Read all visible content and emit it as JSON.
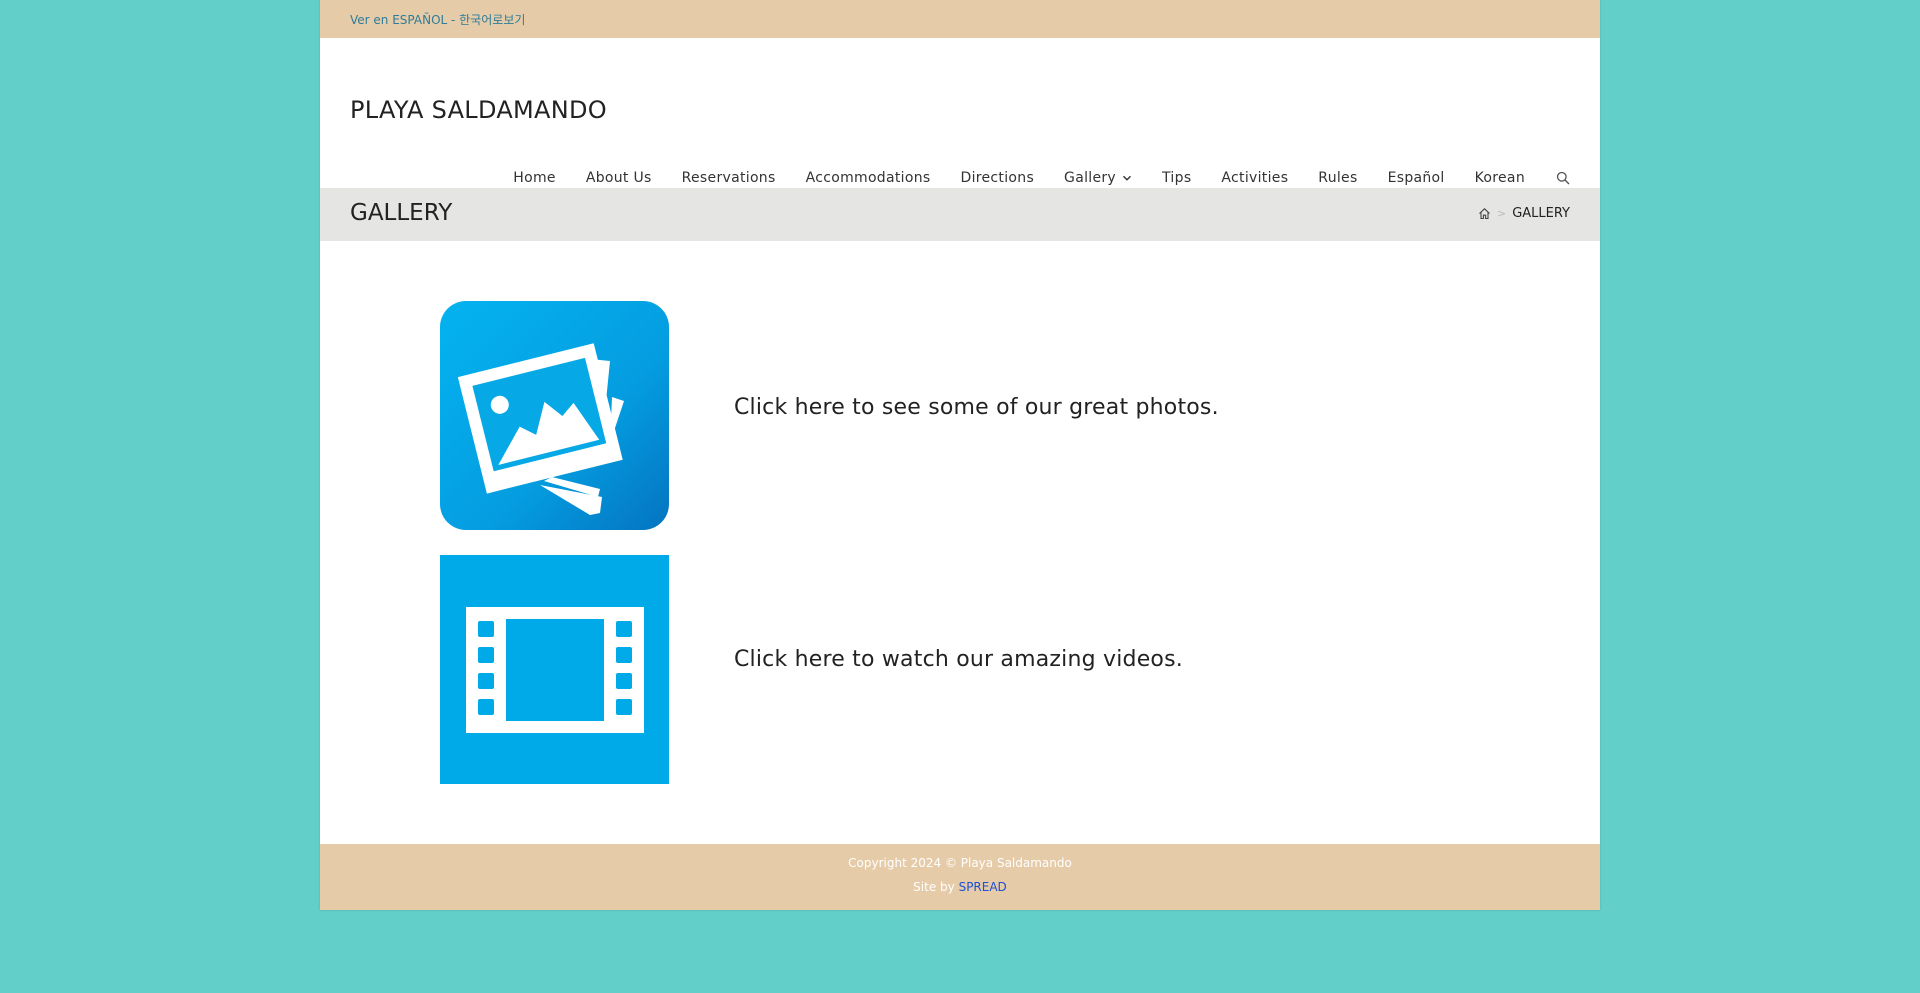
{
  "topbar": {
    "language_links": "Ver en ESPAÑOL - 한국어로보기"
  },
  "header": {
    "site_title": "PLAYA SALDAMANDO",
    "nav": [
      {
        "label": "Home"
      },
      {
        "label": "About Us"
      },
      {
        "label": "Reservations"
      },
      {
        "label": "Accommodations"
      },
      {
        "label": "Directions"
      },
      {
        "label": "Gallery",
        "has_dropdown": true
      },
      {
        "label": "Tips"
      },
      {
        "label": "Activities"
      },
      {
        "label": "Rules"
      },
      {
        "label": "Español"
      },
      {
        "label": "Korean"
      }
    ],
    "search_icon": "search-icon"
  },
  "page_header": {
    "title": "GALLERY",
    "breadcrumb_home_icon": "home-icon",
    "breadcrumb_separator": ">",
    "breadcrumb_current": "GALLERY"
  },
  "main": {
    "photos": {
      "icon": "photos-icon",
      "text": "Click here to see some of our great photos."
    },
    "videos": {
      "icon": "video-film-icon",
      "text": "Click here to watch our amazing videos."
    }
  },
  "footer": {
    "copyright": "Copyright 2024 © Playa Saldamando",
    "site_by_label": "Site by",
    "site_by_link": "SPREAD"
  },
  "colors": {
    "background": "#62cfc9",
    "topbar": "#e6cba8",
    "icon_blue": "#00a9e8",
    "link_blue": "#1e4fd6"
  }
}
